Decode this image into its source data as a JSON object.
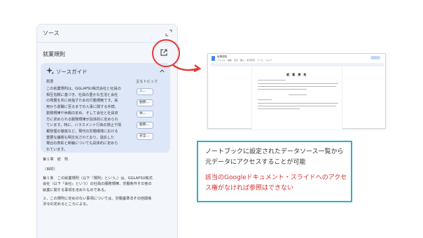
{
  "panel": {
    "title": "ソース",
    "doc_title": "就業規則",
    "guide": {
      "title": "ソースガイド",
      "summary_label": "概要",
      "topics_label": "主なトピック",
      "summary": "この就業規則は、GGLAPSU株式会社と社員の\n相互信頼に基づき、社員の豊かな生活と会社\nの発展を共に目指すための行動規範です。採\n用から退職に至るまでの入事に関する手続、\n勤務規律や休暇の定め、そして会社と社員双\n方に求められる服務規律が具体的に定められ\nています。特に、ハラスメント行為の禁止や情\n報管理の徹底など、現代の労働環境における\n重要な課題も明文化されており、違反した\n場合の表彰と制裁についても具体的に定めら\nれています。",
      "topics": [
        "入...",
        "勤務...",
        "休...",
        "服務...",
        "安全..."
      ]
    },
    "body": {
      "chapter": "第１章　総　則",
      "purpose": "（目的）",
      "article1": "第１条　この就業規則（以下『規則』という。）は、GGLAPSU株式\n会社（以下『会社』という）の社員の服務規律、労働条件その他の\n就業に関する事項を定めたものである。",
      "article2": "２、この規則に定めのない事項については、労働基準法その他関係\n法令の定めるところによる。"
    }
  },
  "doc_window": {
    "filename": "就業規則",
    "menu": "ファイル　編集　表示　挿入　表示形式　ツール　ヘルプ",
    "heading": "就 業 規 則"
  },
  "info": {
    "line1": "ノートブックに設定されたデータソース一覧から\n元データにアクセスすることが可能",
    "line2": "該当のGoogleドキュメント・スライドへのアクセ\nス権がなければ参照はできない"
  },
  "colors": {
    "highlight": "#e53935",
    "info_border": "#2bb1c8",
    "warning_text": "#d32f2f",
    "guide_bg": "#dde7f8"
  },
  "icons": [
    "collapse-icon",
    "open-in-new-icon",
    "sparkle-icon",
    "chevron-up-icon",
    "docs-logo-icon",
    "arrow-icon"
  ]
}
